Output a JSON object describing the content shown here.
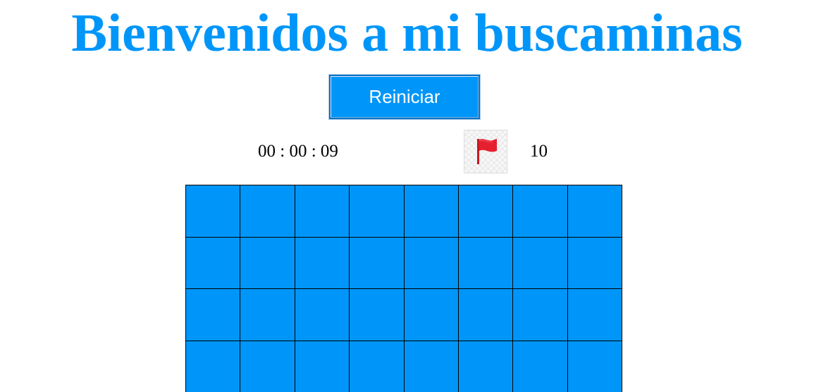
{
  "page": {
    "title": "Bienvenidos a mi buscaminas"
  },
  "controls": {
    "restart_label": "Reiniciar"
  },
  "status": {
    "timer": "00 : 00 : 09",
    "flag_icon": "flag-icon",
    "flags_remaining": "10"
  },
  "board": {
    "rows": 4,
    "columns": 8,
    "cell_state": "covered",
    "cell_color": "#0096f9",
    "grid_color": "#000000"
  },
  "colors": {
    "accent": "#0096f9",
    "flag": "#e5202e"
  }
}
